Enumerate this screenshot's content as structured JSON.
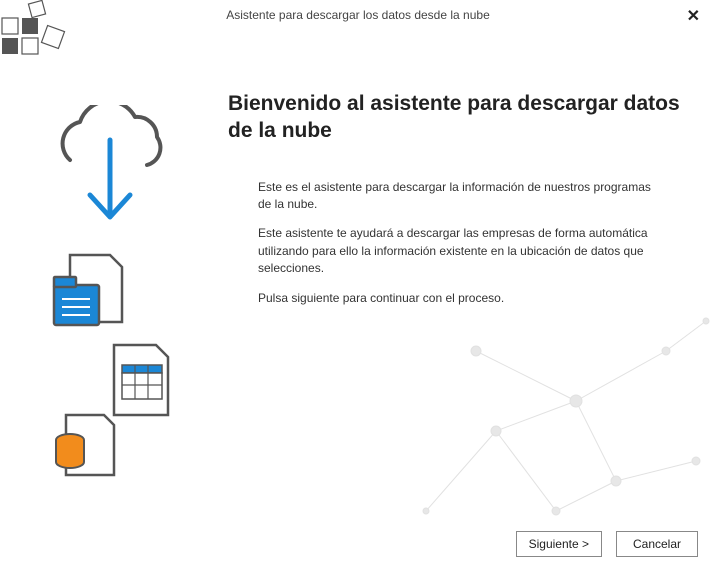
{
  "header": {
    "title": "Asistente para descargar los datos desde la nube"
  },
  "content": {
    "heading": "Bienvenido al asistente para descargar datos de la nube",
    "p1": "Este es el asistente para descargar la información de nuestros programas de la nube.",
    "p2": "Este asistente te ayudará a descargar las empresas de forma automática utilizando para ello la información existente en la ubicación de datos que selecciones.",
    "p3": "Pulsa siguiente para continuar con el proceso."
  },
  "buttons": {
    "next": "Siguiente >",
    "cancel": "Cancelar"
  }
}
